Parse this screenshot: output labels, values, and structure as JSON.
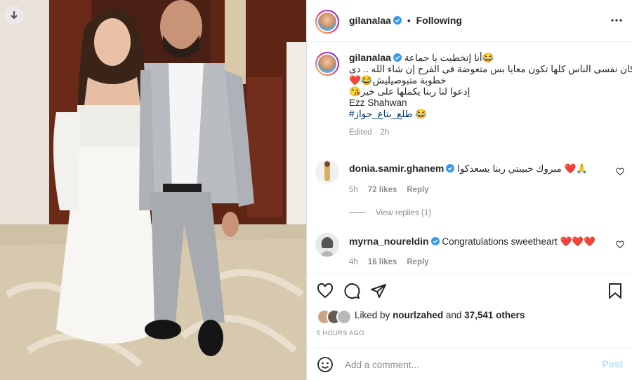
{
  "post": {
    "author": "gilanalaa",
    "follow_status": "Following",
    "dot": "•"
  },
  "caption": {
    "username": "gilanalaa",
    "lines": [
      "😂أنا إتخطيت يا جماعة",
      "كان نفسى الناس كلها تكون معايا بس متعوضة فى الفرح إن شاء الله .. دى",
      "❤️😂خطوبة متبوصيليش",
      "😘إدعوا لنا ربنا يكملها على خير",
      "Ezz Shahwan"
    ],
    "hashtag": "#طلع_بتاع_جواز",
    "hashtag_emoji": "😂",
    "edited": "Edited",
    "time": "2h"
  },
  "comments": [
    {
      "username": "donia.samir.ghanem",
      "text": "🙏❤️ مبروك حبيبتي ربنا يسعدكوا",
      "time": "5h",
      "likes": "72 likes",
      "reply": "Reply",
      "view_replies": "View replies (1)"
    },
    {
      "username": "myrna_noureldin",
      "text": "Congratulations sweetheart ❤️❤️❤️",
      "time": "4h",
      "likes": "16 likes",
      "reply": "Reply"
    }
  ],
  "likes": {
    "prefix": "Liked by",
    "user": "nourlzahed",
    "and": "and",
    "others": "37,541 others"
  },
  "timestamp": "5 HOURS AGO",
  "add_comment": {
    "placeholder": "Add a comment...",
    "post_label": "Post"
  },
  "icons": [
    "download-icon",
    "more-icon",
    "verified-icon",
    "heart-icon",
    "comment-icon",
    "share-icon",
    "save-icon",
    "emoji-icon"
  ],
  "colors": {
    "verified": "#3897f0",
    "link": "#00376b",
    "post": "#b3dbff",
    "muted": "#8e8e8e"
  }
}
